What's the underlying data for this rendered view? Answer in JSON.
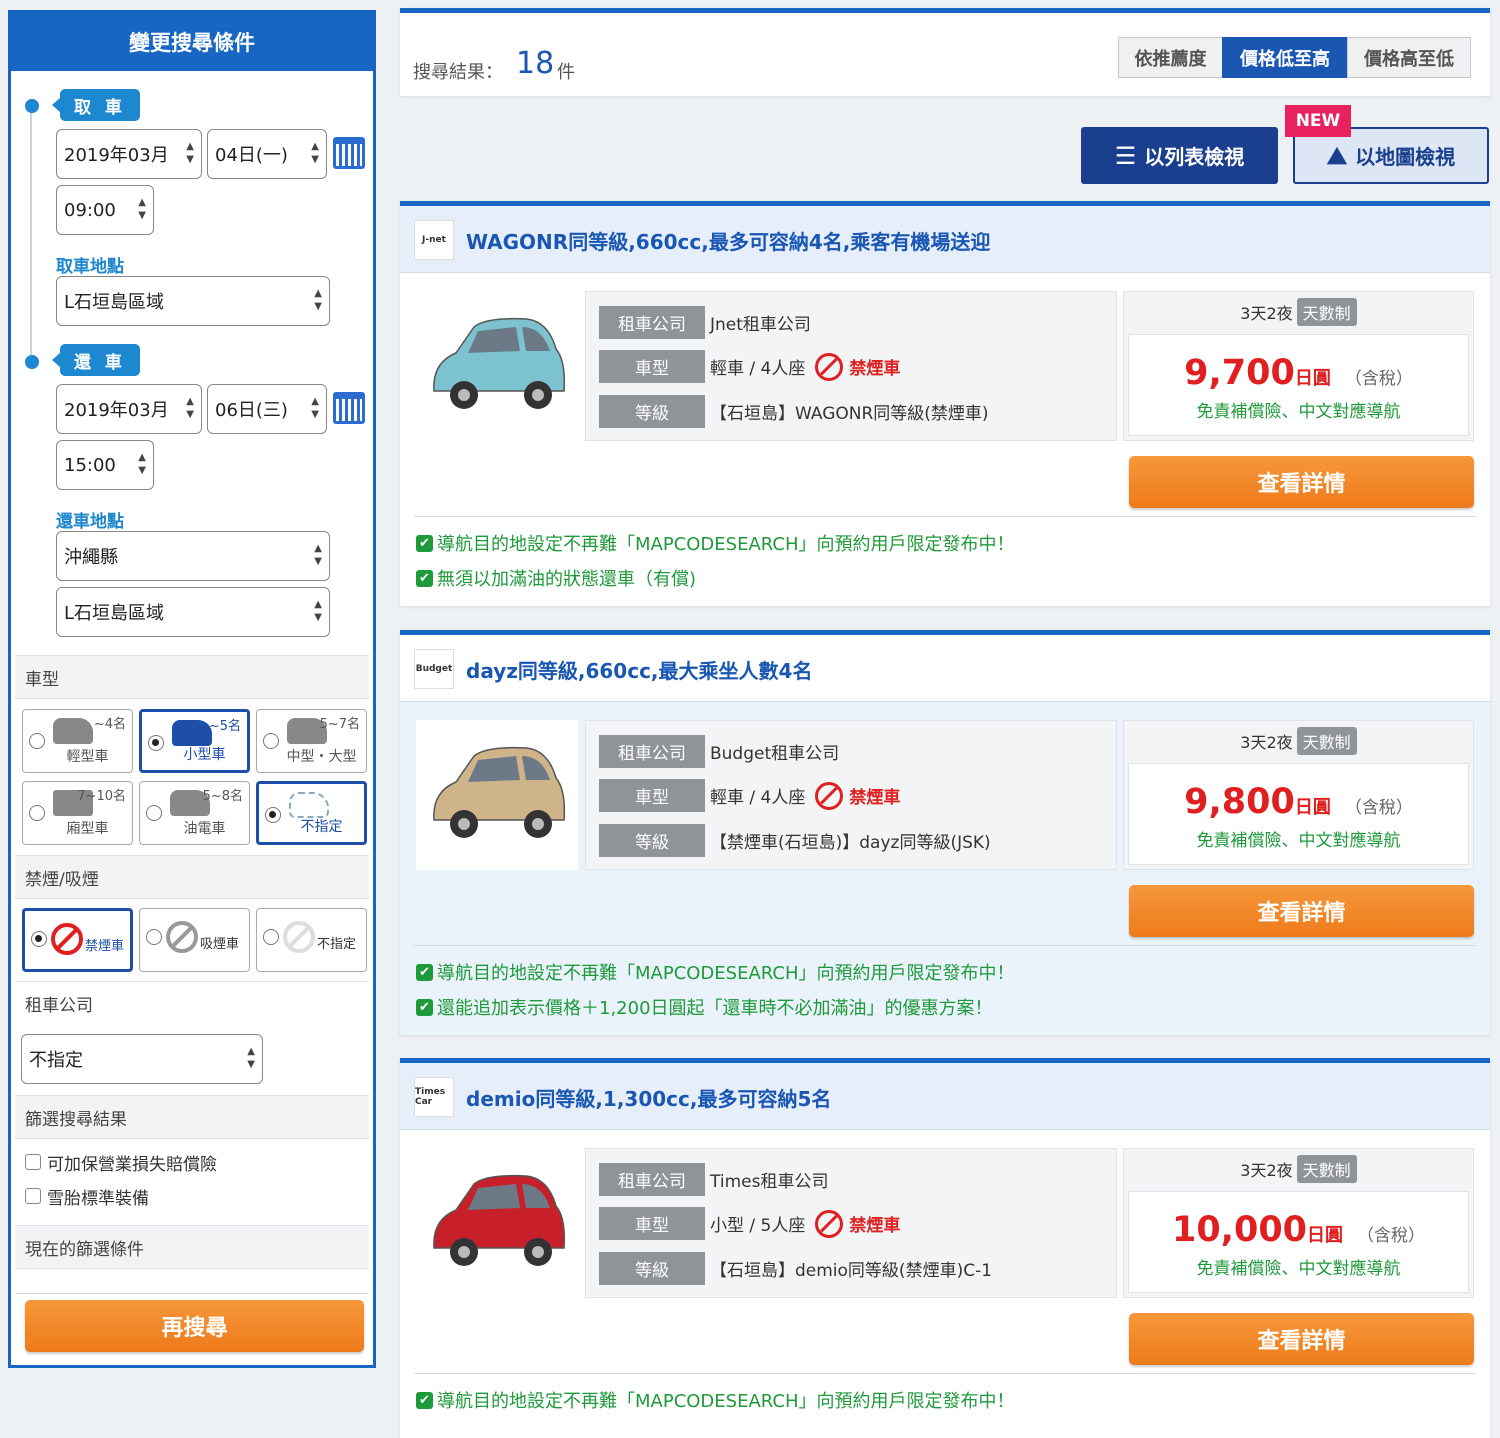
{
  "sidebar": {
    "title": "變更搜尋條件",
    "pickup": {
      "tag": "取 車",
      "month": "2019年03月",
      "day": "04日(一)",
      "time": "09:00",
      "location_label": "取車地點",
      "location": "L石垣島區域"
    },
    "return": {
      "tag": "還 車",
      "month": "2019年03月",
      "day": "06日(三)",
      "time": "15:00",
      "location_label": "還車地點",
      "prefecture": "沖繩縣",
      "location": "L石垣島區域"
    },
    "car_type": {
      "label": "車型",
      "options": [
        {
          "caption": "輕型車",
          "num": "~4名",
          "selected": false
        },
        {
          "caption": "小型車",
          "num": "~5名",
          "selected": false
        },
        {
          "caption": "中型・大型",
          "num": "5~7名",
          "selected": false
        },
        {
          "caption": "廂型車",
          "num": "7~10名",
          "selected": false
        },
        {
          "caption": "油電車",
          "num": "5~8名",
          "selected": false
        },
        {
          "caption": "不指定",
          "num": "",
          "selected": true
        }
      ]
    },
    "smoking": {
      "label": "禁煙/吸煙",
      "options": [
        {
          "caption": "禁煙車",
          "selected": true
        },
        {
          "caption": "吸煙車",
          "selected": false
        },
        {
          "caption": "不指定",
          "selected": false
        }
      ]
    },
    "company": {
      "label": "租車公司",
      "value": "不指定"
    },
    "filter": {
      "label": "篩選搜尋結果",
      "options": [
        "可加保營業損失賠償險",
        "雪胎標準裝備"
      ]
    },
    "current_filter_label": "現在的篩選條件",
    "search_again": "再搜尋"
  },
  "results": {
    "label": "搜尋結果：",
    "count": "18",
    "unit": "件",
    "sort": [
      "依推薦度",
      "價格低至高",
      "價格高至低"
    ],
    "sort_active": "價格低至高",
    "view_list": "以列表檢視",
    "view_map": "以地圖檢視",
    "new_badge": "NEW"
  },
  "labels": {
    "company": "租車公司",
    "type": "車型",
    "grade": "等級",
    "details": "查看詳情",
    "nonsmoking": "禁煙車",
    "duration": "3天2夜",
    "duration_badge": "天數制",
    "yen": "日圓",
    "tax": "（含稅）",
    "price_note": "免責補償險、中文對應導航"
  },
  "cards": [
    {
      "logo": "J-net",
      "title": "WAGONR同等級,660cc,最多可容納4名,乘客有機場送迎",
      "company": "Jnet租車公司",
      "type": "輕車 / 4人座",
      "grade": "【石垣島】WAGONR同等級(禁煙車)",
      "price": "9,700",
      "features": [
        "導航目的地設定不再難「MAPCODESEARCH」向預約用戶限定發布中！",
        "無須以加滿油的狀態還車（有償)"
      ],
      "car_color": "#7cc3cf"
    },
    {
      "logo": "Budget",
      "title": "dayz同等級,660cc,最大乘坐人數4名",
      "company": "Budget租車公司",
      "type": "輕車 / 4人座",
      "grade": "【禁煙車(石垣島)】dayz同等級(JSK)",
      "price": "9,800",
      "features": [
        "導航目的地設定不再難「MAPCODESEARCH」向預約用戶限定發布中！",
        "還能追加表示價格＋1,200日圓起「還車時不必加滿油」的優惠方案！"
      ],
      "car_color": "#cfb48a"
    },
    {
      "logo": "Times Car",
      "title": "demio同等級,1,300cc,最多可容納5名",
      "company": "Times租車公司",
      "type": "小型 / 5人座",
      "grade": "【石垣島】demio同等級(禁煙車)C-1",
      "price": "10,000",
      "features": [
        "導航目的地設定不再難「MAPCODESEARCH」向預約用戶限定發布中！"
      ],
      "car_color": "#c8202a"
    }
  ]
}
